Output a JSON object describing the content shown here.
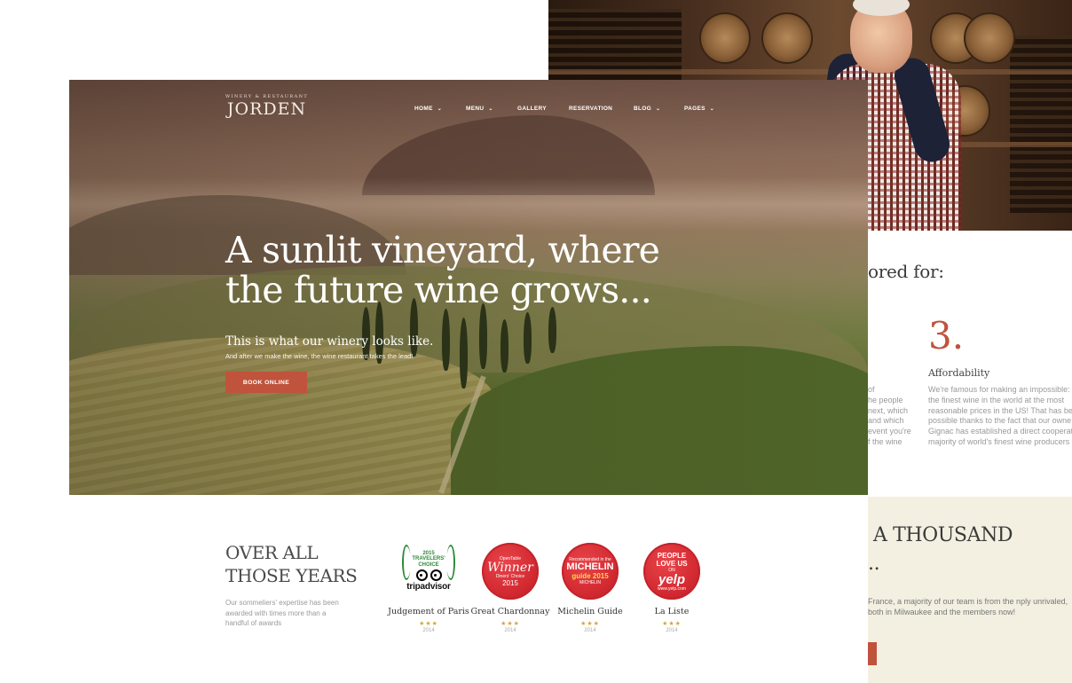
{
  "background_page": {
    "section_heading": "ored for:",
    "feature": {
      "number": "3.",
      "title": "Affordability",
      "text": "We're famous for making an impossible: s the finest wine in the world at the most reasonable prices in the US! That has bee possible thanks to the fact that our owne Gignac has established a direct cooperati majority of world's finest wine producers"
    },
    "partial_feature_text": [
      "of",
      "he people",
      "next, which",
      "and which",
      "event you're",
      "f the wine"
    ],
    "cream_section": {
      "title_line1": "A THOUSAND",
      "title_line2": "..",
      "text": "France, a majority of our team is from the nply unrivaled, both in Milwaukee and the members now!"
    }
  },
  "hero": {
    "logo_sub": "WINERY & RESTAURANT",
    "logo_main": "JORDEN",
    "nav": [
      {
        "label": "HOME",
        "has_dropdown": true
      },
      {
        "label": "MENU",
        "has_dropdown": true
      },
      {
        "label": "GALLERY",
        "has_dropdown": false
      },
      {
        "label": "RESERVATION",
        "has_dropdown": false
      },
      {
        "label": "BLOG",
        "has_dropdown": true
      },
      {
        "label": "PAGES",
        "has_dropdown": true
      }
    ],
    "title_line1": "A sunlit vineyard, where",
    "title_line2": "the future wine grows...",
    "subtitle": "This is what our winery looks like.",
    "subtitle2": "And after we make the wine, the wine restaurant takes the lead!",
    "cta": "BOOK ONLINE",
    "accent_color": "#c0533c"
  },
  "awards_section": {
    "title_line1": "OVER ALL",
    "title_line2": "THOSE YEARS",
    "text": "Our sommeliers' expertise has been awarded with times more than a handful of awards",
    "awards": [
      {
        "badge": {
          "top": "2015",
          "line2": "TRAVELERS'",
          "line3": "CHOICE",
          "brand": "tripadvisor"
        },
        "name": "Judgement of Paris",
        "stars": "★★★",
        "year": "2014"
      },
      {
        "badge": {
          "top": "OpenTable",
          "line2": "Winner",
          "line3": "Diners' Choice",
          "line4": "2015"
        },
        "name": "Great Chardonnay",
        "stars": "★★★",
        "year": "2014"
      },
      {
        "badge": {
          "top": "Recommended in the",
          "line2": "MICHELIN",
          "line3": "guide 2015",
          "line4": "MICHELIN"
        },
        "name": "Michelin Guide",
        "stars": "★★★",
        "year": "2014"
      },
      {
        "badge": {
          "top": "PEOPLE",
          "line2": "LOVE US",
          "line3": "ON",
          "brand": "yelp",
          "url": "www.yelp.com"
        },
        "name": "La Liste",
        "stars": "★★★",
        "year": "2014"
      }
    ]
  }
}
